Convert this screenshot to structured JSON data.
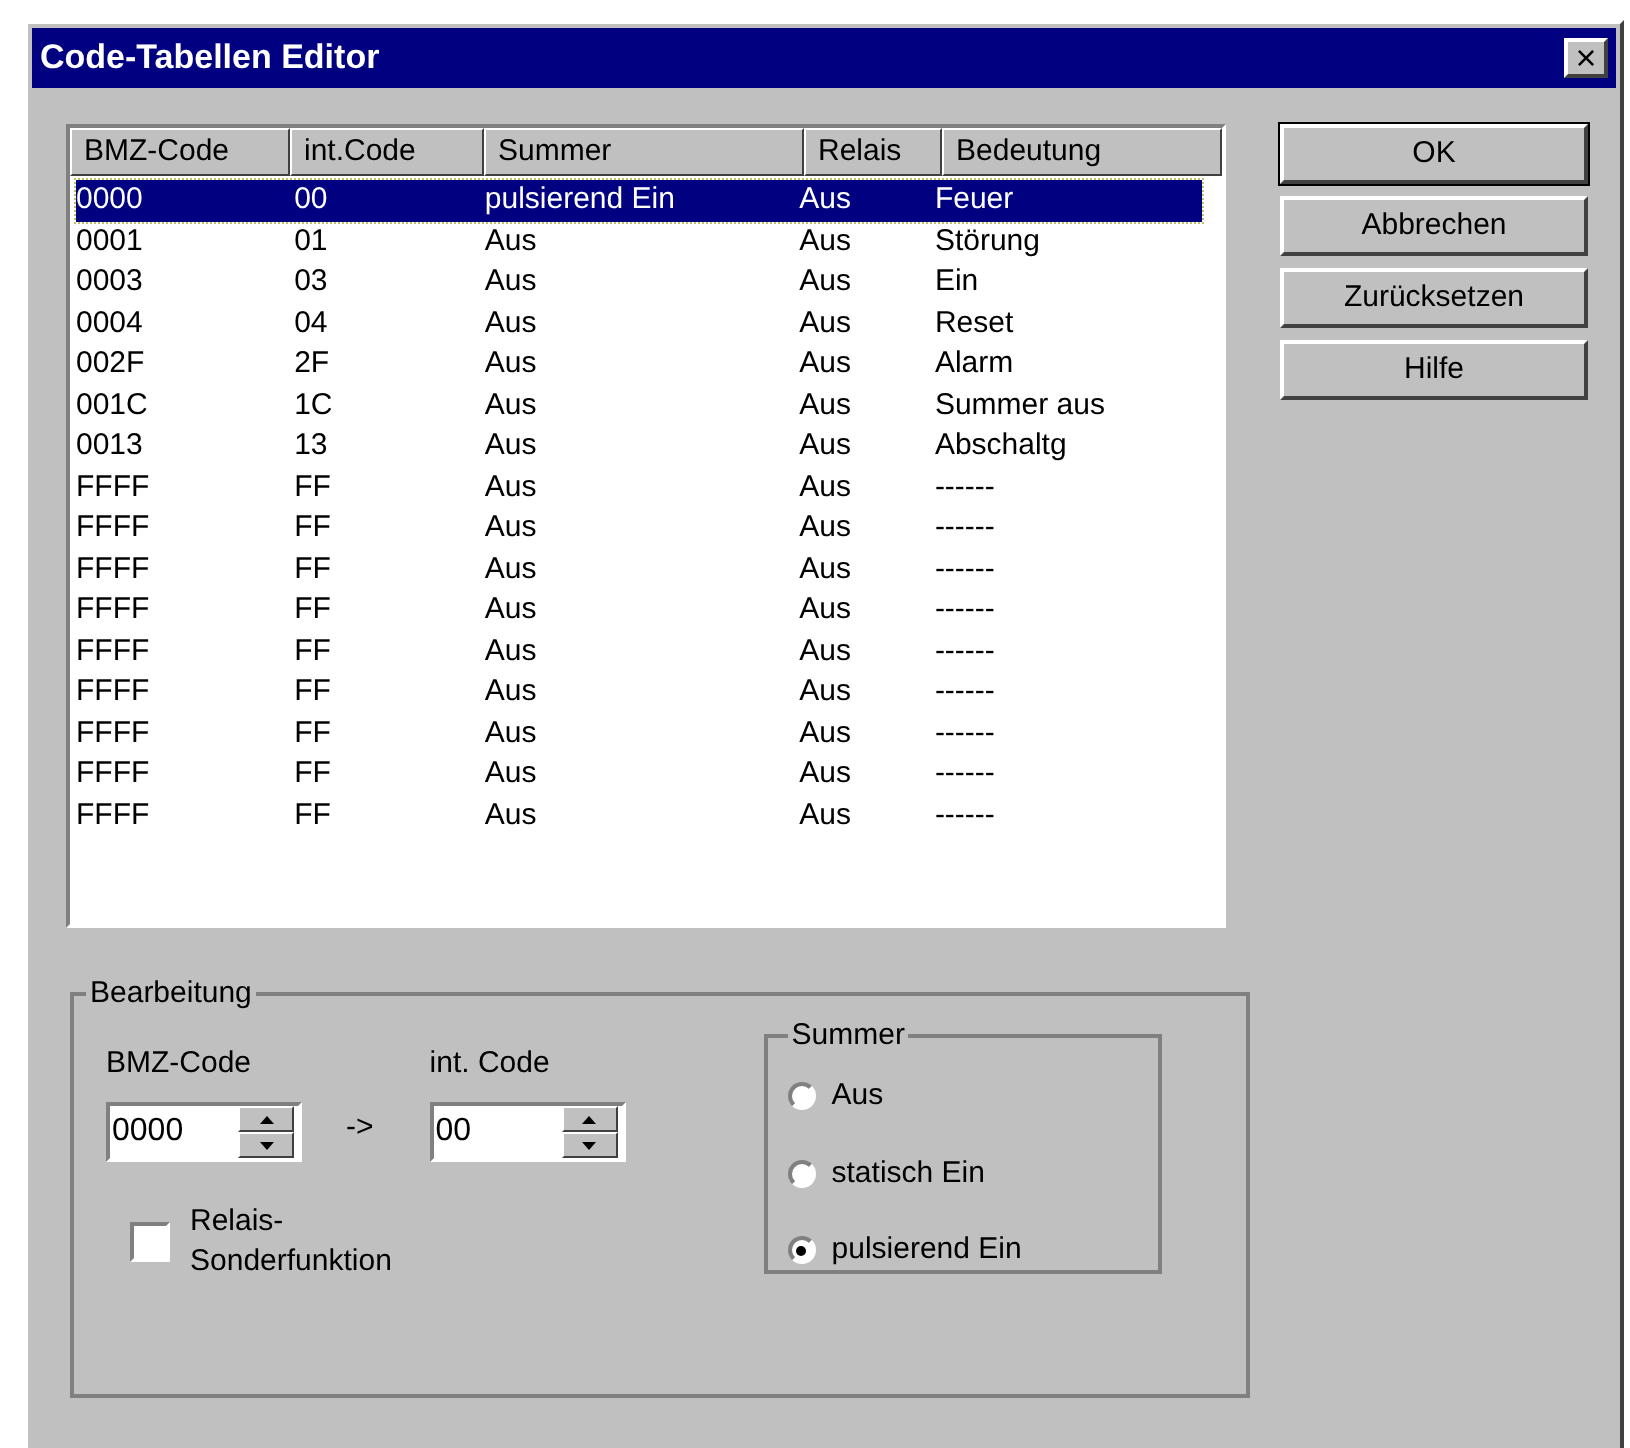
{
  "window": {
    "title": "Code-Tabellen Editor",
    "close": "×"
  },
  "table": {
    "columns": [
      "BMZ-Code",
      "int.Code",
      "Summer",
      "Relais",
      "Bedeutung"
    ],
    "rows": [
      {
        "cells": [
          "0000",
          "00",
          "pulsierend Ein",
          "Aus",
          "Feuer"
        ],
        "selected": true
      },
      {
        "cells": [
          "0001",
          "01",
          "Aus",
          "Aus",
          "Störung"
        ],
        "selected": false
      },
      {
        "cells": [
          "0003",
          "03",
          "Aus",
          "Aus",
          "Ein"
        ],
        "selected": false
      },
      {
        "cells": [
          "0004",
          "04",
          "Aus",
          "Aus",
          "Reset"
        ],
        "selected": false
      },
      {
        "cells": [
          "002F",
          "2F",
          "Aus",
          "Aus",
          "Alarm"
        ],
        "selected": false
      },
      {
        "cells": [
          "001C",
          "1C",
          "Aus",
          "Aus",
          "Summer aus"
        ],
        "selected": false
      },
      {
        "cells": [
          "0013",
          "13",
          "Aus",
          "Aus",
          "Abschaltg"
        ],
        "selected": false
      },
      {
        "cells": [
          "FFFF",
          "FF",
          "Aus",
          "Aus",
          "------"
        ],
        "selected": false
      },
      {
        "cells": [
          "FFFF",
          "FF",
          "Aus",
          "Aus",
          "------"
        ],
        "selected": false
      },
      {
        "cells": [
          "FFFF",
          "FF",
          "Aus",
          "Aus",
          "------"
        ],
        "selected": false
      },
      {
        "cells": [
          "FFFF",
          "FF",
          "Aus",
          "Aus",
          "------"
        ],
        "selected": false
      },
      {
        "cells": [
          "FFFF",
          "FF",
          "Aus",
          "Aus",
          "------"
        ],
        "selected": false
      },
      {
        "cells": [
          "FFFF",
          "FF",
          "Aus",
          "Aus",
          "------"
        ],
        "selected": false
      },
      {
        "cells": [
          "FFFF",
          "FF",
          "Aus",
          "Aus",
          "------"
        ],
        "selected": false
      },
      {
        "cells": [
          "FFFF",
          "FF",
          "Aus",
          "Aus",
          "------"
        ],
        "selected": false
      },
      {
        "cells": [
          "FFFF",
          "FF",
          "Aus",
          "Aus",
          "------"
        ],
        "selected": false
      }
    ]
  },
  "buttons": [
    {
      "label": "OK",
      "default": true
    },
    {
      "label": "Abbrechen",
      "default": false
    },
    {
      "label": "Zurücksetzen",
      "default": false
    },
    {
      "label": "Hilfe",
      "default": false
    }
  ],
  "editing": {
    "title": "Bearbeitung",
    "bmz_label": "BMZ-Code",
    "bmz_value": "0000",
    "arrow": "->",
    "int_label": "int. Code",
    "int_value": "00",
    "relay_checkbox": {
      "label": "Relais-\nSonderfunktion",
      "checked": false
    },
    "summer": {
      "title": "Summer",
      "options": [
        {
          "label": "Aus",
          "selected": false
        },
        {
          "label": "statisch Ein",
          "selected": false
        },
        {
          "label": "pulsierend Ein",
          "selected": true
        }
      ]
    }
  }
}
